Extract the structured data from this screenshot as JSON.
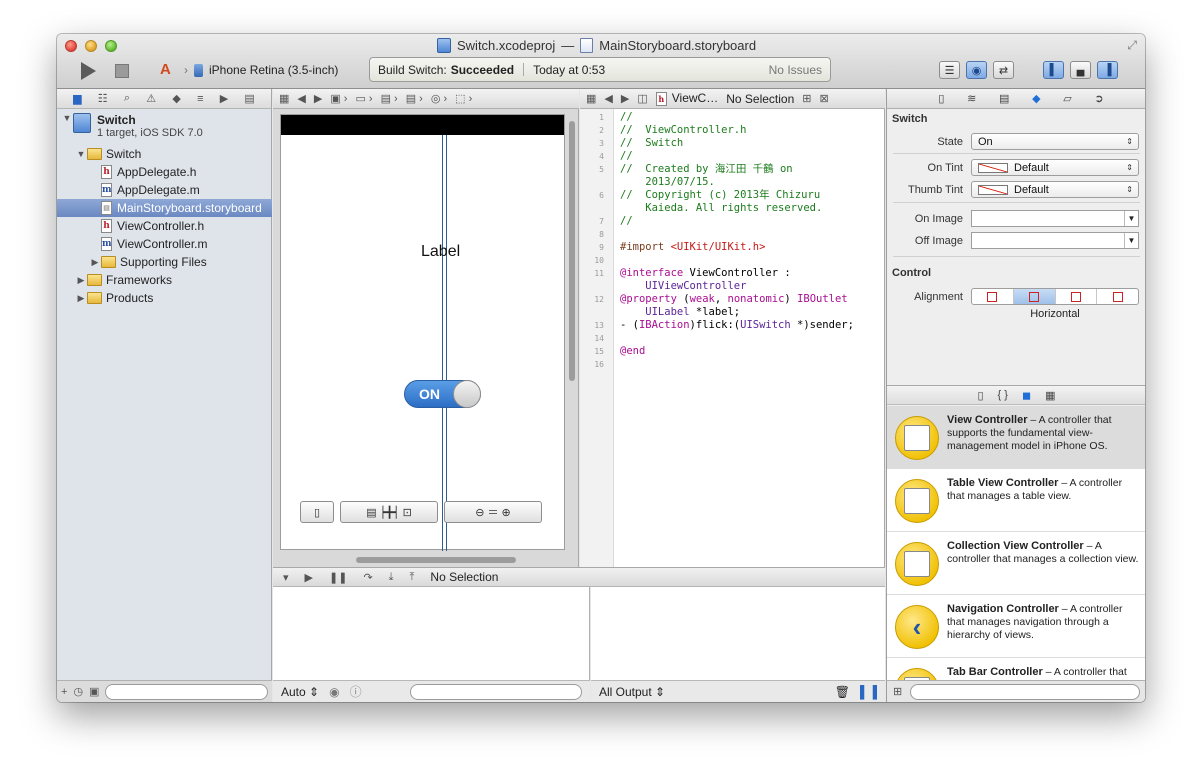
{
  "window": {
    "project_name": "Switch.xcodeproj",
    "separator": "—",
    "file_name": "MainStoryboard.storyboard"
  },
  "toolbar": {
    "scheme_target": "iPhone Retina (3.5-inch)",
    "activity_prefix": "Build Switch:",
    "activity_status": "Succeeded",
    "activity_time": "Today at 0:53",
    "issues": "No Issues"
  },
  "navigator": {
    "project": {
      "name": "Switch",
      "subtitle": "1 target, iOS SDK 7.0"
    },
    "items": [
      {
        "label": "Switch",
        "kind": "folder",
        "indent": 1,
        "expanded": true
      },
      {
        "label": "AppDelegate.h",
        "kind": "h",
        "indent": 2
      },
      {
        "label": "AppDelegate.m",
        "kind": "m",
        "indent": 2
      },
      {
        "label": "MainStoryboard.storyboard",
        "kind": "storyboard",
        "indent": 2,
        "selected": true
      },
      {
        "label": "ViewController.h",
        "kind": "h",
        "indent": 2
      },
      {
        "label": "ViewController.m",
        "kind": "m",
        "indent": 2
      },
      {
        "label": "Supporting Files",
        "kind": "folder",
        "indent": 2,
        "expanded": false
      },
      {
        "label": "Frameworks",
        "kind": "folder",
        "indent": 1,
        "expanded": false
      },
      {
        "label": "Products",
        "kind": "folder",
        "indent": 1,
        "expanded": false
      }
    ]
  },
  "jumpbar_right": {
    "file_label": "ViewC…",
    "selection": "No Selection"
  },
  "canvas": {
    "label_text": "Label",
    "switch_text": "ON",
    "switch_on": true
  },
  "code": {
    "lines": [
      {
        "n": "1",
        "parts": [
          [
            "c-com",
            "//"
          ]
        ]
      },
      {
        "n": "2",
        "parts": [
          [
            "c-com",
            "//  ViewController.h"
          ]
        ]
      },
      {
        "n": "3",
        "parts": [
          [
            "c-com",
            "//  Switch"
          ]
        ]
      },
      {
        "n": "4",
        "parts": [
          [
            "c-com",
            "//"
          ]
        ]
      },
      {
        "n": "5",
        "parts": [
          [
            "c-com",
            "//  Created by 海江田 千鶴 on"
          ]
        ]
      },
      {
        "n": "",
        "parts": [
          [
            "c-com",
            "    2013/07/15."
          ]
        ]
      },
      {
        "n": "6",
        "parts": [
          [
            "c-com",
            "//  Copyright (c) 2013年 Chizuru"
          ]
        ]
      },
      {
        "n": "",
        "parts": [
          [
            "c-com",
            "    Kaieda. All rights reserved."
          ]
        ]
      },
      {
        "n": "7",
        "parts": [
          [
            "c-com",
            "//"
          ]
        ]
      },
      {
        "n": "8",
        "parts": [
          [
            "c-plain",
            ""
          ]
        ]
      },
      {
        "n": "9",
        "parts": [
          [
            "c-dir",
            "#import "
          ],
          [
            "c-str",
            "<UIKit/UIKit.h>"
          ]
        ]
      },
      {
        "n": "10",
        "parts": [
          [
            "c-plain",
            ""
          ]
        ]
      },
      {
        "n": "11",
        "parts": [
          [
            "c-kw",
            "@interface"
          ],
          [
            "c-plain",
            " ViewController :"
          ]
        ]
      },
      {
        "n": "",
        "parts": [
          [
            "c-cls",
            "    UIViewController"
          ]
        ]
      },
      {
        "n": "12",
        "bp": true,
        "parts": [
          [
            "c-kw",
            "@property"
          ],
          [
            "c-plain",
            " ("
          ],
          [
            "c-kw",
            "weak"
          ],
          [
            "c-plain",
            ", "
          ],
          [
            "c-kw",
            "nonatomic"
          ],
          [
            "c-plain",
            ") "
          ],
          [
            "c-kw",
            "IBOutlet"
          ]
        ]
      },
      {
        "n": "",
        "parts": [
          [
            "c-cls",
            "    UILabel"
          ],
          [
            "c-plain",
            " *label;"
          ]
        ]
      },
      {
        "n": "13",
        "bp": true,
        "parts": [
          [
            "c-plain",
            "- ("
          ],
          [
            "c-kw",
            "IBAction"
          ],
          [
            "c-plain",
            ")flick:("
          ],
          [
            "c-cls",
            "UISwitch"
          ],
          [
            "c-plain",
            " *)sender;"
          ]
        ]
      },
      {
        "n": "14",
        "parts": [
          [
            "c-plain",
            ""
          ]
        ]
      },
      {
        "n": "15",
        "parts": [
          [
            "c-kw",
            "@end"
          ]
        ]
      },
      {
        "n": "16",
        "parts": [
          [
            "c-plain",
            ""
          ]
        ]
      }
    ]
  },
  "debug": {
    "selection": "No Selection",
    "left_mode": "Auto",
    "right_mode": "All Output"
  },
  "inspector": {
    "section_switch": "Switch",
    "state_label": "State",
    "state_value": "On",
    "on_tint_label": "On Tint",
    "on_tint_value": "Default",
    "thumb_tint_label": "Thumb Tint",
    "thumb_tint_value": "Default",
    "on_image_label": "On Image",
    "off_image_label": "Off Image",
    "section_control": "Control",
    "alignment_label": "Alignment",
    "horizontal_label": "Horizontal"
  },
  "library": {
    "items": [
      {
        "title": "View Controller",
        "desc": " – A controller that supports the fundamental view-management model in iPhone OS.",
        "icon": "view-controller",
        "selected": true
      },
      {
        "title": "Table View Controller",
        "desc": " – A controller that manages a table view.",
        "icon": "table-view-controller"
      },
      {
        "title": "Collection View Controller",
        "desc": " – A controller that manages a collection view.",
        "icon": "collection-view-controller"
      },
      {
        "title": "Navigation Controller",
        "desc": " – A controller that manages navigation through a hierarchy of views.",
        "icon": "navigation-controller"
      },
      {
        "title": "Tab Bar Controller",
        "desc": " – A controller that manages a set of view controllers that represent tab bar items.",
        "icon": "tab-bar-controller"
      }
    ]
  },
  "colors": {
    "selection": "#6a88c2",
    "switch_on": "#2d6ec6",
    "library_icon": "#f0c000",
    "comment": "#1c7c1c",
    "keyword": "#aa0d91"
  }
}
